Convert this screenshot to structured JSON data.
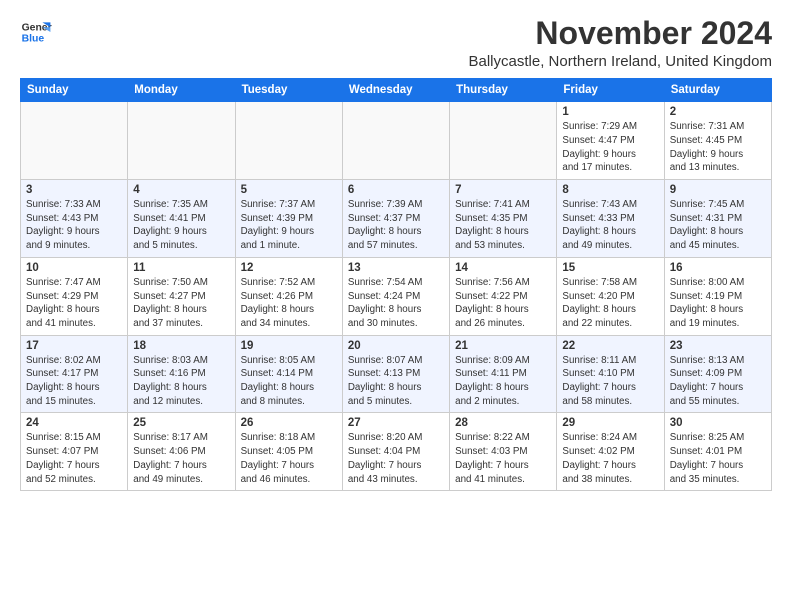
{
  "logo": {
    "line1": "General",
    "line2": "Blue"
  },
  "title": "November 2024",
  "subtitle": "Ballycastle, Northern Ireland, United Kingdom",
  "weekdays": [
    "Sunday",
    "Monday",
    "Tuesday",
    "Wednesday",
    "Thursday",
    "Friday",
    "Saturday"
  ],
  "weeks": [
    [
      {
        "day": "",
        "info": ""
      },
      {
        "day": "",
        "info": ""
      },
      {
        "day": "",
        "info": ""
      },
      {
        "day": "",
        "info": ""
      },
      {
        "day": "",
        "info": ""
      },
      {
        "day": "1",
        "info": "Sunrise: 7:29 AM\nSunset: 4:47 PM\nDaylight: 9 hours\nand 17 minutes."
      },
      {
        "day": "2",
        "info": "Sunrise: 7:31 AM\nSunset: 4:45 PM\nDaylight: 9 hours\nand 13 minutes."
      }
    ],
    [
      {
        "day": "3",
        "info": "Sunrise: 7:33 AM\nSunset: 4:43 PM\nDaylight: 9 hours\nand 9 minutes."
      },
      {
        "day": "4",
        "info": "Sunrise: 7:35 AM\nSunset: 4:41 PM\nDaylight: 9 hours\nand 5 minutes."
      },
      {
        "day": "5",
        "info": "Sunrise: 7:37 AM\nSunset: 4:39 PM\nDaylight: 9 hours\nand 1 minute."
      },
      {
        "day": "6",
        "info": "Sunrise: 7:39 AM\nSunset: 4:37 PM\nDaylight: 8 hours\nand 57 minutes."
      },
      {
        "day": "7",
        "info": "Sunrise: 7:41 AM\nSunset: 4:35 PM\nDaylight: 8 hours\nand 53 minutes."
      },
      {
        "day": "8",
        "info": "Sunrise: 7:43 AM\nSunset: 4:33 PM\nDaylight: 8 hours\nand 49 minutes."
      },
      {
        "day": "9",
        "info": "Sunrise: 7:45 AM\nSunset: 4:31 PM\nDaylight: 8 hours\nand 45 minutes."
      }
    ],
    [
      {
        "day": "10",
        "info": "Sunrise: 7:47 AM\nSunset: 4:29 PM\nDaylight: 8 hours\nand 41 minutes."
      },
      {
        "day": "11",
        "info": "Sunrise: 7:50 AM\nSunset: 4:27 PM\nDaylight: 8 hours\nand 37 minutes."
      },
      {
        "day": "12",
        "info": "Sunrise: 7:52 AM\nSunset: 4:26 PM\nDaylight: 8 hours\nand 34 minutes."
      },
      {
        "day": "13",
        "info": "Sunrise: 7:54 AM\nSunset: 4:24 PM\nDaylight: 8 hours\nand 30 minutes."
      },
      {
        "day": "14",
        "info": "Sunrise: 7:56 AM\nSunset: 4:22 PM\nDaylight: 8 hours\nand 26 minutes."
      },
      {
        "day": "15",
        "info": "Sunrise: 7:58 AM\nSunset: 4:20 PM\nDaylight: 8 hours\nand 22 minutes."
      },
      {
        "day": "16",
        "info": "Sunrise: 8:00 AM\nSunset: 4:19 PM\nDaylight: 8 hours\nand 19 minutes."
      }
    ],
    [
      {
        "day": "17",
        "info": "Sunrise: 8:02 AM\nSunset: 4:17 PM\nDaylight: 8 hours\nand 15 minutes."
      },
      {
        "day": "18",
        "info": "Sunrise: 8:03 AM\nSunset: 4:16 PM\nDaylight: 8 hours\nand 12 minutes."
      },
      {
        "day": "19",
        "info": "Sunrise: 8:05 AM\nSunset: 4:14 PM\nDaylight: 8 hours\nand 8 minutes."
      },
      {
        "day": "20",
        "info": "Sunrise: 8:07 AM\nSunset: 4:13 PM\nDaylight: 8 hours\nand 5 minutes."
      },
      {
        "day": "21",
        "info": "Sunrise: 8:09 AM\nSunset: 4:11 PM\nDaylight: 8 hours\nand 2 minutes."
      },
      {
        "day": "22",
        "info": "Sunrise: 8:11 AM\nSunset: 4:10 PM\nDaylight: 7 hours\nand 58 minutes."
      },
      {
        "day": "23",
        "info": "Sunrise: 8:13 AM\nSunset: 4:09 PM\nDaylight: 7 hours\nand 55 minutes."
      }
    ],
    [
      {
        "day": "24",
        "info": "Sunrise: 8:15 AM\nSunset: 4:07 PM\nDaylight: 7 hours\nand 52 minutes."
      },
      {
        "day": "25",
        "info": "Sunrise: 8:17 AM\nSunset: 4:06 PM\nDaylight: 7 hours\nand 49 minutes."
      },
      {
        "day": "26",
        "info": "Sunrise: 8:18 AM\nSunset: 4:05 PM\nDaylight: 7 hours\nand 46 minutes."
      },
      {
        "day": "27",
        "info": "Sunrise: 8:20 AM\nSunset: 4:04 PM\nDaylight: 7 hours\nand 43 minutes."
      },
      {
        "day": "28",
        "info": "Sunrise: 8:22 AM\nSunset: 4:03 PM\nDaylight: 7 hours\nand 41 minutes."
      },
      {
        "day": "29",
        "info": "Sunrise: 8:24 AM\nSunset: 4:02 PM\nDaylight: 7 hours\nand 38 minutes."
      },
      {
        "day": "30",
        "info": "Sunrise: 8:25 AM\nSunset: 4:01 PM\nDaylight: 7 hours\nand 35 minutes."
      }
    ]
  ]
}
